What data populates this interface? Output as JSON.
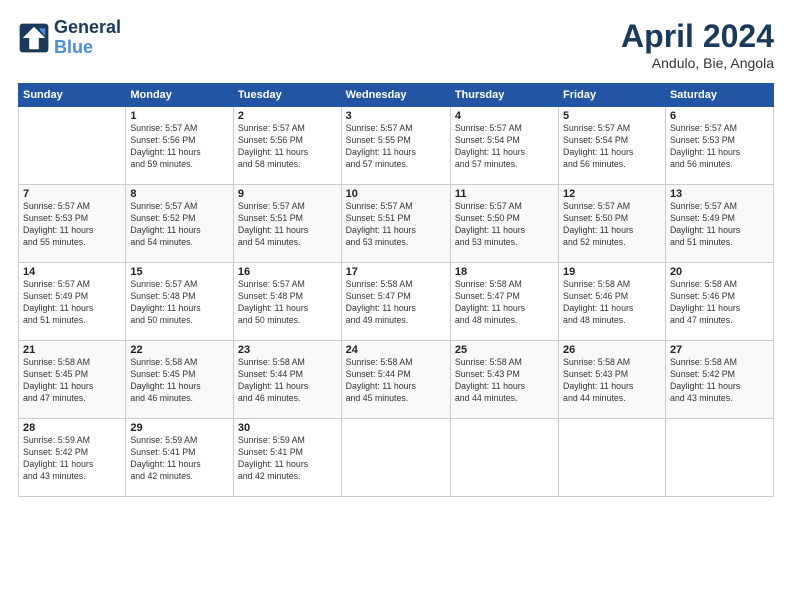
{
  "header": {
    "logo_line1": "General",
    "logo_line2": "Blue",
    "month": "April 2024",
    "location": "Andulo, Bie, Angola"
  },
  "columns": [
    "Sunday",
    "Monday",
    "Tuesday",
    "Wednesday",
    "Thursday",
    "Friday",
    "Saturday"
  ],
  "weeks": [
    [
      {
        "day": "",
        "info": ""
      },
      {
        "day": "1",
        "info": "Sunrise: 5:57 AM\nSunset: 5:56 PM\nDaylight: 11 hours\nand 59 minutes."
      },
      {
        "day": "2",
        "info": "Sunrise: 5:57 AM\nSunset: 5:56 PM\nDaylight: 11 hours\nand 58 minutes."
      },
      {
        "day": "3",
        "info": "Sunrise: 5:57 AM\nSunset: 5:55 PM\nDaylight: 11 hours\nand 57 minutes."
      },
      {
        "day": "4",
        "info": "Sunrise: 5:57 AM\nSunset: 5:54 PM\nDaylight: 11 hours\nand 57 minutes."
      },
      {
        "day": "5",
        "info": "Sunrise: 5:57 AM\nSunset: 5:54 PM\nDaylight: 11 hours\nand 56 minutes."
      },
      {
        "day": "6",
        "info": "Sunrise: 5:57 AM\nSunset: 5:53 PM\nDaylight: 11 hours\nand 56 minutes."
      }
    ],
    [
      {
        "day": "7",
        "info": "Sunrise: 5:57 AM\nSunset: 5:53 PM\nDaylight: 11 hours\nand 55 minutes."
      },
      {
        "day": "8",
        "info": "Sunrise: 5:57 AM\nSunset: 5:52 PM\nDaylight: 11 hours\nand 54 minutes."
      },
      {
        "day": "9",
        "info": "Sunrise: 5:57 AM\nSunset: 5:51 PM\nDaylight: 11 hours\nand 54 minutes."
      },
      {
        "day": "10",
        "info": "Sunrise: 5:57 AM\nSunset: 5:51 PM\nDaylight: 11 hours\nand 53 minutes."
      },
      {
        "day": "11",
        "info": "Sunrise: 5:57 AM\nSunset: 5:50 PM\nDaylight: 11 hours\nand 53 minutes."
      },
      {
        "day": "12",
        "info": "Sunrise: 5:57 AM\nSunset: 5:50 PM\nDaylight: 11 hours\nand 52 minutes."
      },
      {
        "day": "13",
        "info": "Sunrise: 5:57 AM\nSunset: 5:49 PM\nDaylight: 11 hours\nand 51 minutes."
      }
    ],
    [
      {
        "day": "14",
        "info": "Sunrise: 5:57 AM\nSunset: 5:49 PM\nDaylight: 11 hours\nand 51 minutes."
      },
      {
        "day": "15",
        "info": "Sunrise: 5:57 AM\nSunset: 5:48 PM\nDaylight: 11 hours\nand 50 minutes."
      },
      {
        "day": "16",
        "info": "Sunrise: 5:57 AM\nSunset: 5:48 PM\nDaylight: 11 hours\nand 50 minutes."
      },
      {
        "day": "17",
        "info": "Sunrise: 5:58 AM\nSunset: 5:47 PM\nDaylight: 11 hours\nand 49 minutes."
      },
      {
        "day": "18",
        "info": "Sunrise: 5:58 AM\nSunset: 5:47 PM\nDaylight: 11 hours\nand 48 minutes."
      },
      {
        "day": "19",
        "info": "Sunrise: 5:58 AM\nSunset: 5:46 PM\nDaylight: 11 hours\nand 48 minutes."
      },
      {
        "day": "20",
        "info": "Sunrise: 5:58 AM\nSunset: 5:46 PM\nDaylight: 11 hours\nand 47 minutes."
      }
    ],
    [
      {
        "day": "21",
        "info": "Sunrise: 5:58 AM\nSunset: 5:45 PM\nDaylight: 11 hours\nand 47 minutes."
      },
      {
        "day": "22",
        "info": "Sunrise: 5:58 AM\nSunset: 5:45 PM\nDaylight: 11 hours\nand 46 minutes."
      },
      {
        "day": "23",
        "info": "Sunrise: 5:58 AM\nSunset: 5:44 PM\nDaylight: 11 hours\nand 46 minutes."
      },
      {
        "day": "24",
        "info": "Sunrise: 5:58 AM\nSunset: 5:44 PM\nDaylight: 11 hours\nand 45 minutes."
      },
      {
        "day": "25",
        "info": "Sunrise: 5:58 AM\nSunset: 5:43 PM\nDaylight: 11 hours\nand 44 minutes."
      },
      {
        "day": "26",
        "info": "Sunrise: 5:58 AM\nSunset: 5:43 PM\nDaylight: 11 hours\nand 44 minutes."
      },
      {
        "day": "27",
        "info": "Sunrise: 5:58 AM\nSunset: 5:42 PM\nDaylight: 11 hours\nand 43 minutes."
      }
    ],
    [
      {
        "day": "28",
        "info": "Sunrise: 5:59 AM\nSunset: 5:42 PM\nDaylight: 11 hours\nand 43 minutes."
      },
      {
        "day": "29",
        "info": "Sunrise: 5:59 AM\nSunset: 5:41 PM\nDaylight: 11 hours\nand 42 minutes."
      },
      {
        "day": "30",
        "info": "Sunrise: 5:59 AM\nSunset: 5:41 PM\nDaylight: 11 hours\nand 42 minutes."
      },
      {
        "day": "",
        "info": ""
      },
      {
        "day": "",
        "info": ""
      },
      {
        "day": "",
        "info": ""
      },
      {
        "day": "",
        "info": ""
      }
    ]
  ]
}
